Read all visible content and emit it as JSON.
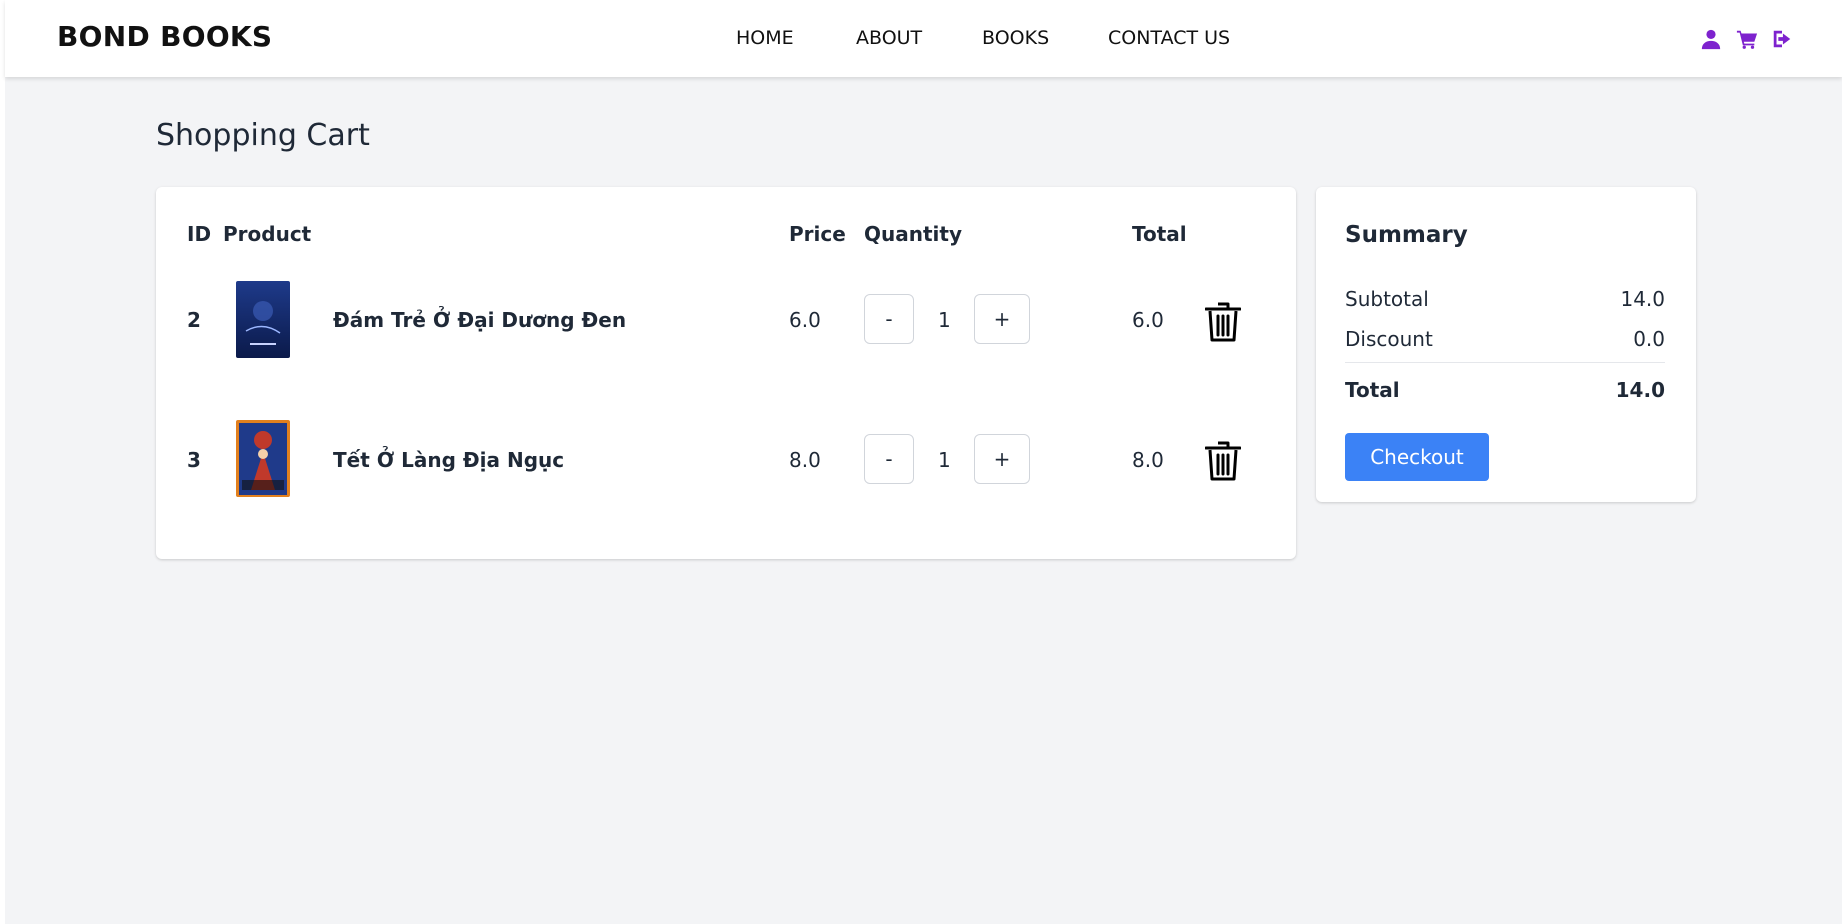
{
  "brand": "BOND BOOKS",
  "nav": {
    "links": [
      "HOME",
      "ABOUT",
      "BOOKS",
      "CONTACT US"
    ],
    "icons": [
      "user-icon",
      "cart-icon",
      "logout-icon"
    ],
    "icon_color": "#7e22ce"
  },
  "page_title": "Shopping Cart",
  "cart": {
    "headers": {
      "id": "ID",
      "product": "Product",
      "price": "Price",
      "quantity": "Quantity",
      "total": "Total"
    },
    "rows": [
      {
        "id": "2",
        "name": "Đám Trẻ Ở Đại Dương Đen",
        "price": "6.0",
        "minus": "-",
        "qty": "1",
        "plus": "+",
        "total": "6.0"
      },
      {
        "id": "3",
        "name": "Tết Ở Làng Địa Ngục",
        "price": "8.0",
        "minus": "-",
        "qty": "1",
        "plus": "+",
        "total": "8.0"
      }
    ]
  },
  "summary": {
    "title": "Summary",
    "subtotal_label": "Subtotal",
    "subtotal_value": "14.0",
    "discount_label": "Discount",
    "discount_value": "0.0",
    "total_label": "Total",
    "total_value": "14.0",
    "checkout_label": "Checkout"
  },
  "colors": {
    "accent": "#3b82f6",
    "page_bg": "#f3f4f6"
  }
}
